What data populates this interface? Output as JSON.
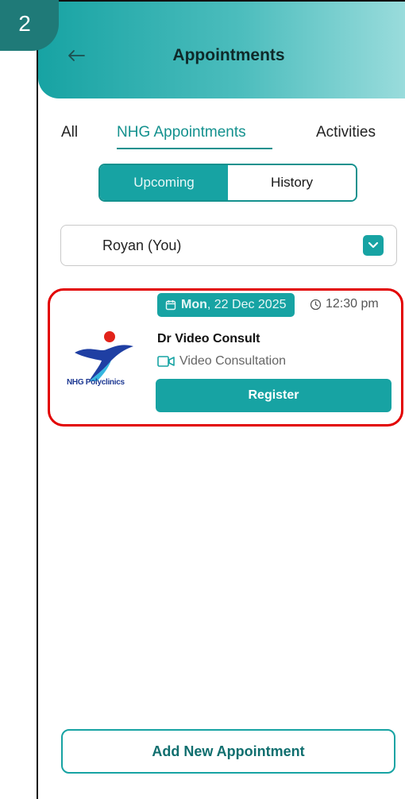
{
  "step_badge": "2",
  "header": {
    "title": "Appointments",
    "back_icon": "arrow-left-icon"
  },
  "tabs": [
    {
      "label": "All",
      "active": false
    },
    {
      "label": "NHG Appointments",
      "active": true
    },
    {
      "label": "Activities",
      "active": false
    }
  ],
  "segment": {
    "upcoming_label": "Upcoming",
    "history_label": "History",
    "selected": "Upcoming"
  },
  "patient_select": {
    "value": "Royan (You)",
    "icon": "chevron-down-icon"
  },
  "appointment": {
    "date_day": "Mon",
    "date_rest": ", 22 Dec 2025",
    "time": "12:30 pm",
    "doctor": "Dr Video Consult",
    "type": "Video Consultation",
    "clinic_logo_text": "NHG Polyclinics",
    "register_label": "Register"
  },
  "add_button_label": "Add New Appointment",
  "colors": {
    "teal": "#17a3a3",
    "teal_dark": "#14918e",
    "highlight_red": "#e20000",
    "badge": "#1f7a78"
  }
}
